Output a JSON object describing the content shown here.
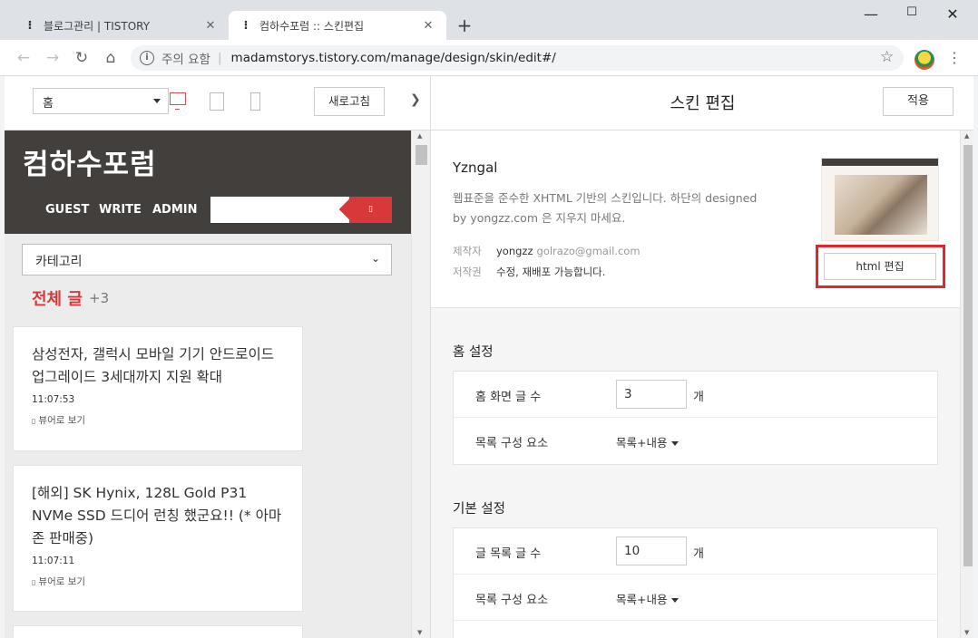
{
  "browser": {
    "tabs": [
      {
        "label": "블로그관리 | TISTORY",
        "active": false,
        "favicon": "tistory-icon"
      },
      {
        "label": "컴하수포럼 :: 스킨편집",
        "active": true,
        "favicon": "tistory-icon"
      }
    ],
    "new_tab": "+",
    "address": {
      "security_label": "주의 요함",
      "separator": "|",
      "url": "madamstorys.tistory.com/manage/design/skin/edit#/"
    }
  },
  "preview": {
    "page_select": "홈",
    "refresh_label": "새로고침",
    "blog": {
      "title": "컴하수포럼",
      "nav": [
        "GUEST",
        "WRITE",
        "ADMIN"
      ],
      "search_button_glyph": "▯",
      "category_select": "카테고리",
      "all_posts_label": "전체 글",
      "all_posts_count": "+3",
      "posts": [
        {
          "title": "삼성전자, 갤럭시 모바일 기기 안드로이드 업그레이드 3세대까지 지원 확대",
          "time": "11:07:53",
          "viewer": "뷰어로 보기"
        },
        {
          "title": "[해외] SK Hynix, 128L Gold P31 NVMe SSD 드디어 런칭 했군요!! (* 아마존 판매중)",
          "time": "11:07:11",
          "viewer": "뷰어로 보기"
        }
      ]
    }
  },
  "editor": {
    "title": "스킨 편집",
    "apply_label": "적용",
    "skin": {
      "name": "Yzngal",
      "description": "웹표준을 준수한 XHTML 기반의 스킨입니다. 하단의 designed by yongzz.com 은 지우지 마세요.",
      "maker_key": "제작자",
      "maker_name": "yongzz",
      "maker_email": "golrazo@gmail.com",
      "copyright_key": "저작권",
      "copyright_value": "수정, 재배포 가능합니다.",
      "html_edit_label": "html 편집"
    },
    "home_settings": {
      "title": "홈 설정",
      "rows": [
        {
          "label": "홈 화면 글 수",
          "value": "3",
          "unit": "개"
        },
        {
          "label": "목록 구성 요소",
          "dropdown": "목록+내용"
        }
      ]
    },
    "basic_settings": {
      "title": "기본 설정",
      "rows": [
        {
          "label": "글 목록 글 수",
          "value": "10",
          "unit": "개"
        },
        {
          "label": "목록 구성 요소",
          "dropdown": "목록+내용"
        }
      ]
    }
  },
  "colors": {
    "accent_red": "#d9383a",
    "highlight_red": "#e3262d",
    "blog_header": "#433f3d"
  }
}
